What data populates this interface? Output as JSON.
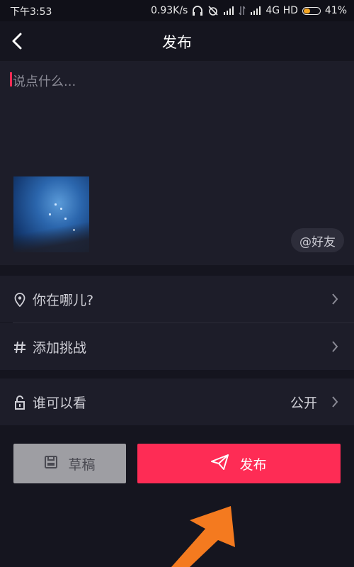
{
  "status_bar": {
    "time": "下午3:53",
    "speed": "0.93K/s",
    "network": "4G HD",
    "battery": "41%"
  },
  "header": {
    "title": "发布",
    "back_icon": "chevron-left-icon"
  },
  "compose": {
    "placeholder": "说点什么...",
    "mention_label": "@好友"
  },
  "options": {
    "location_label": "你在哪儿?",
    "challenge_label": "添加挑战",
    "visibility_label": "谁可以看",
    "visibility_value": "公开"
  },
  "actions": {
    "draft_label": "草稿",
    "publish_label": "发布"
  },
  "colors": {
    "accent": "#fe2c55",
    "background": "#15151f",
    "panel": "#1d1d29",
    "annotation_arrow": "#f47a1f"
  }
}
